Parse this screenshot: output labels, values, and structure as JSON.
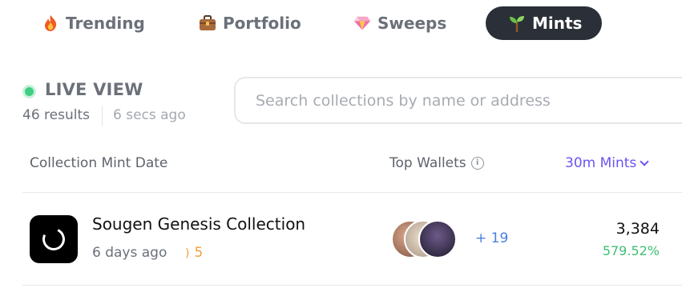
{
  "tabs": [
    {
      "label": "Trending",
      "icon": "fire-icon",
      "active": false
    },
    {
      "label": "Portfolio",
      "icon": "briefcase-icon",
      "active": false
    },
    {
      "label": "Sweeps",
      "icon": "gem-icon",
      "active": false
    },
    {
      "label": "Mints",
      "icon": "sprout-icon",
      "active": true
    }
  ],
  "live": {
    "title": "LIVE VIEW",
    "results": "46 results",
    "updated": "6 secs ago"
  },
  "search": {
    "placeholder": "Search collections by name or address",
    "value": ""
  },
  "table": {
    "headers": {
      "collection": "Collection Mint Date",
      "wallets": "Top Wallets",
      "mints": "30m Mints"
    },
    "rows": [
      {
        "name": "Sougen Genesis Collection",
        "age": "6 days ago",
        "streak": "5",
        "more_wallets": "+ 19",
        "mints": "3,384",
        "change": "579.52%"
      }
    ]
  },
  "colors": {
    "active_tab_bg": "#2b2f37",
    "live_dot": "#3fcf84",
    "accent": "#6a55f0",
    "positive": "#3fbf74",
    "link_blue": "#4a7fe0",
    "streak": "#f0a03a"
  }
}
